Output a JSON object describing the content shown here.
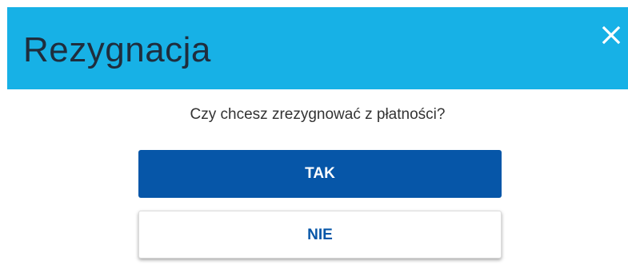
{
  "dialog": {
    "title": "Rezygnacja",
    "close_icon": "close-icon",
    "question": "Czy chcesz zrezygnować z płatności?",
    "yes_label": "TAK",
    "no_label": "NIE"
  },
  "colors": {
    "header_bg": "#17b1e6",
    "title_text": "#1f2d3d",
    "primary_button": "#0656a8",
    "secondary_button_text": "#0656a8"
  }
}
